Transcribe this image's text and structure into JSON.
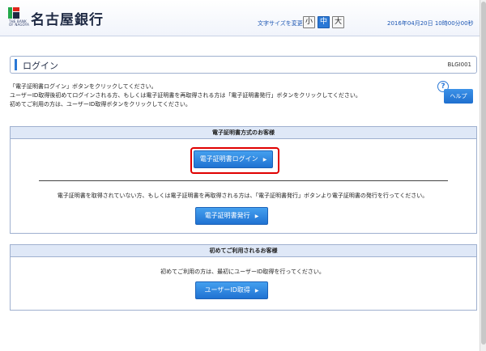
{
  "header": {
    "bank_name": "名古屋銀行",
    "logo_sub": "THE BANK OF NAGOYA",
    "text_size_label": "文字サイズを変更",
    "size_small": "小",
    "size_medium": "中",
    "size_large": "大",
    "datetime": "2016年04月20日 10時00分00秒"
  },
  "page": {
    "title": "ログイン",
    "screen_id": "BLGI001",
    "instructions": [
      "「電子証明書ログイン」ボタンをクリックしてください。",
      "ユーザーID取得後初めてログインされる方、もしくは電子証明書を再取得される方は「電子証明書発行」ボタンをクリックしてください。",
      "初めてご利用の方は、ユーザーID取得ボタンをクリックしてください。"
    ],
    "help_label": "ヘルプ"
  },
  "section_cert": {
    "heading": "電子証明書方式のお客様",
    "login_button": "電子証明書ログイン",
    "note": "電子証明書を取得されていない方、もしくは電子証明書を再取得される方は、「電子証明書発行」ボタンより電子証明書の発行を行ってください。",
    "issue_button": "電子証明書発行"
  },
  "section_first": {
    "heading": "初めてご利用されるお客様",
    "note": "初めてご利用の方は、最初にユーザーID取得を行ってください。",
    "userid_button": "ユーザーID取得"
  },
  "colors": {
    "accent": "#2a78d6",
    "highlight": "#e00000",
    "section_header_bg": "#dfe8f7"
  }
}
